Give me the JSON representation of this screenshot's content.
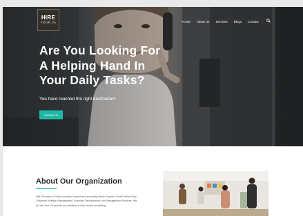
{
  "logo": {
    "line1": "HIRE",
    "line2": "YOUR VA"
  },
  "nav": {
    "items": [
      "Home",
      "About Us",
      "Services",
      "Blogs",
      "Contact"
    ]
  },
  "hero": {
    "headline_lines": [
      "Are You Looking For",
      "A Helping Hand In",
      "Your Daily Tasks?"
    ],
    "subtitle": "You have reached the right destination!",
    "cta": "Contact Us"
  },
  "about": {
    "title": "About Our Organization",
    "paragraph": "With 15 years of Virtual assistant experience providing Admin Support, Social Media Help, Customer Relation Management, Business Development, and Management Services. We at Hire Your VA provide you assistance with almost everything."
  },
  "colors": {
    "accent": "#1fb7a6",
    "hero_overlay": "#3b3d3f"
  },
  "icons": {
    "search": "search-icon"
  }
}
